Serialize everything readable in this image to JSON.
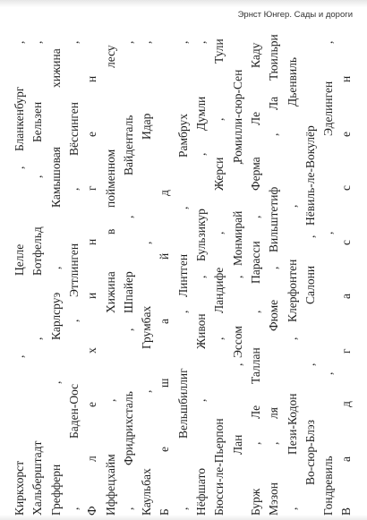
{
  "running_header": "Эрнст Юнгер. Сады и дороги",
  "lines": [
    [
      [
        "Киркхорст",
        0
      ],
      [
        ",",
        176
      ],
      [
        "Целле",
        268
      ],
      [
        ",",
        387
      ],
      [
        "Бланкенбург",
        407
      ],
      [
        ",",
        527
      ]
    ],
    [
      [
        "Хальберштадт",
        0
      ],
      [
        ",",
        196
      ],
      [
        "Ботфельд",
        268
      ],
      [
        ",",
        377
      ],
      [
        "Бельзен",
        417
      ],
      [
        ",",
        527
      ]
    ],
    [
      [
        "Грефферн",
        0
      ],
      [
        ",",
        147
      ],
      [
        "Карлсруэ",
        196
      ],
      [
        ",",
        275
      ],
      [
        "Камышовая",
        344
      ],
      [
        "хижина",
        478
      ]
    ],
    [
      [
        ",",
        6
      ],
      [
        "Баден-Оос",
        86
      ],
      [
        ",",
        216
      ],
      [
        "Эттлинген",
        244
      ],
      [
        ",",
        363
      ],
      [
        "Вёссинген",
        402
      ],
      [
        ",",
        527
      ]
    ],
    [
      [
        "Ф",
        0
      ],
      [
        "л",
        60
      ],
      [
        "е",
        121
      ],
      [
        "х",
        181
      ],
      [
        "и",
        242
      ],
      [
        "н",
        302
      ],
      [
        "г",
        363
      ],
      [
        "е",
        423
      ],
      [
        "н",
        484
      ]
    ],
    [
      [
        "Иффецхайм",
        0
      ],
      [
        ",",
        127
      ],
      [
        "Хижина",
        226
      ],
      [
        "в",
        314
      ],
      [
        "пойменном",
        344
      ],
      [
        "лесу",
        500
      ]
    ],
    [
      [
        ",",
        6
      ],
      [
        "Фридрихсталь",
        56
      ],
      [
        ",",
        206
      ],
      [
        "Шпайер",
        226
      ],
      [
        ",",
        332
      ],
      [
        "Вайденталь",
        380
      ],
      [
        ",",
        527
      ]
    ],
    [
      [
        "Каульбах",
        0
      ],
      [
        ",",
        137
      ],
      [
        "Грумбах",
        186
      ],
      [
        ",",
        303
      ],
      [
        "Идар",
        420
      ],
      [
        ",",
        527
      ]
    ],
    [
      [
        "Б",
        0
      ],
      [
        "е",
        71
      ],
      [
        "ш",
        143
      ],
      [
        "а",
        214
      ],
      [
        "й",
        286
      ],
      [
        "д",
        357
      ]
    ],
    [
      [
        ",",
        6
      ],
      [
        "Вельшбиллиг",
        86
      ],
      [
        ",",
        226
      ],
      [
        "Линтген",
        244
      ],
      [
        ",",
        342
      ],
      [
        "Рамбрух",
        400
      ],
      [
        ",",
        527
      ]
    ],
    [
      [
        "Нёфшато",
        0
      ],
      [
        ",",
        127
      ],
      [
        "Живон",
        186
      ],
      [
        ",",
        265
      ],
      [
        "Бульзикур",
        284
      ],
      [
        ",",
        402
      ],
      [
        "Думли",
        430
      ],
      [
        ",",
        527
      ]
    ],
    [
      [
        "Бюсси-ле-Пьерпон",
        0
      ],
      [
        ",",
        196
      ],
      [
        "Ландифе",
        226
      ],
      [
        ",",
        314
      ],
      [
        "Жерси",
        363
      ],
      [
        ",",
        441
      ],
      [
        "Тули",
        505
      ]
    ],
    [
      [
        "Лан",
        68
      ],
      [
        ",",
        167
      ],
      [
        "Эссом",
        176
      ],
      [
        ",",
        265
      ],
      [
        "Монмирай",
        279
      ],
      [
        ",",
        392
      ],
      [
        "Ромилли-сюр-Сен",
        394
      ]
    ],
    [
      [
        "Бурж",
        0
      ],
      [
        ",",
        79
      ],
      [
        "Ле",
        108
      ],
      [
        "Таллан",
        147
      ],
      [
        ",",
        226
      ],
      [
        "Парасси",
        259
      ],
      [
        ",",
        332
      ],
      [
        "Ферма",
        363
      ],
      [
        "Ле",
        436
      ],
      [
        "Каду",
        500
      ]
    ],
    [
      [
        "Мэзон",
        0
      ],
      [
        ",",
        79
      ],
      [
        "ля",
        108
      ],
      [
        "Фюме",
        206
      ],
      [
        ",",
        275
      ],
      [
        "Вильштетиф",
        294
      ],
      [
        ",",
        424
      ],
      [
        "Ла",
        453
      ],
      [
        "Тюильри",
        486
      ]
    ],
    [
      [
        ",",
        6
      ],
      [
        "Пези-Кодон",
        68
      ],
      [
        ",",
        196
      ],
      [
        "Клерфонтен",
        216
      ],
      [
        ",",
        344
      ],
      [
        "Дьенвиль",
        457
      ]
    ],
    [
      [
        "Во-сюр-Блэз",
        34
      ],
      [
        ",",
        167
      ],
      [
        "Салони",
        236
      ],
      [
        ",",
        310
      ],
      [
        "Нёвиль-ле-Вокулёр",
        324
      ]
    ],
    [
      [
        "Гондревиль",
        0
      ],
      [
        ",",
        157
      ],
      [
        ",",
        314
      ],
      [
        "Эделинген",
        424
      ],
      [
        ",",
        527
      ]
    ],
    [
      [
        "В",
        0
      ],
      [
        "а",
        60
      ],
      [
        "д",
        121
      ],
      [
        "г",
        181
      ],
      [
        "а",
        242
      ],
      [
        "с",
        302
      ],
      [
        "с",
        363
      ],
      [
        "е",
        423
      ],
      [
        "н",
        484
      ]
    ]
  ]
}
